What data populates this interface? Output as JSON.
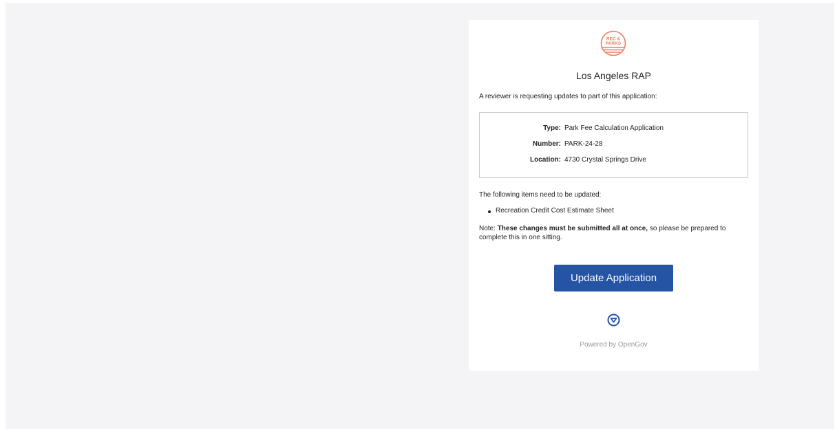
{
  "org": {
    "logo_line1": "REC &",
    "logo_line2": "PARKS",
    "name": "Los Angeles RAP"
  },
  "intro_text": "A reviewer is requesting updates to part of this application:",
  "details": {
    "type_label": "Type:",
    "type_value": "Park Fee Calculation Application",
    "number_label": "Number:",
    "number_value": "PARK-24-28",
    "location_label": "Location:",
    "location_value": "4730 Crystal Springs Drive"
  },
  "items_heading": "The following items need to be updated:",
  "items": [
    "Recreation Credit Cost Estimate Sheet"
  ],
  "note": {
    "prefix": "Note: ",
    "bold": "These changes must be submitted all at once,",
    "suffix": " so please be prepared to complete this in one sitting."
  },
  "button_label": "Update Application",
  "footer_text": "Powered by OpenGov",
  "colors": {
    "brand_orange": "#e8805f",
    "button_blue": "#2554a5",
    "opengov_blue": "#2554a5"
  }
}
